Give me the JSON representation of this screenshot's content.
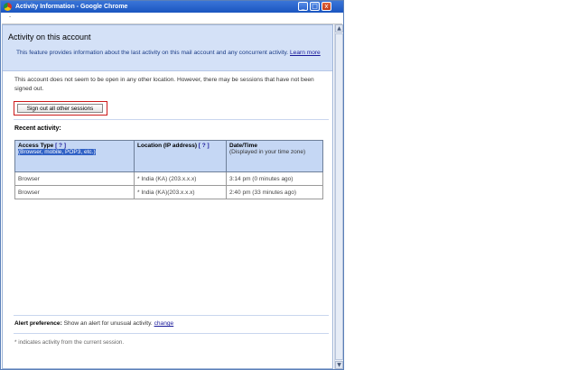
{
  "window": {
    "title": "Activity Information - Google Chrome",
    "address": "-",
    "controls": {
      "minimize": "_",
      "maximize": "□",
      "close": "x"
    }
  },
  "header": {
    "title": "Activity on this account",
    "description": "This feature provides information about the last activity on this mail account and any concurrent activity.",
    "learn_more": "Learn more"
  },
  "note": "This account does not seem to be open in any other location. However, there may be sessions that have not been signed out.",
  "sign_out_button": "Sign out all other sessions",
  "recent_activity_label": "Recent activity:",
  "table": {
    "columns": [
      {
        "label": "Access Type",
        "help": "[ ? ]",
        "sub": "(Browser, mobile, POP3, etc.)"
      },
      {
        "label": "Location (IP address)",
        "help": "[ ? ]",
        "sub": ""
      },
      {
        "label": "Date/Time",
        "help": "",
        "sub": "(Displayed in your time zone)"
      }
    ],
    "rows": [
      {
        "access": "Browser",
        "location": "* India (KA) (203.x.x.x)",
        "time": "3:14 pm (0 minutes ago)"
      },
      {
        "access": "Browser",
        "location": "* India (KA)(203.x.x.x)",
        "time": "2:40 pm (33 minutes ago)"
      }
    ]
  },
  "alert": {
    "label": "Alert preference:",
    "text": "Show an alert for unusual activity.",
    "change": "change"
  },
  "footnote": "* indicates activity from the current session.",
  "colors": {
    "titlebar": "#1a55c0",
    "header_bg": "#d4e1f7",
    "table_header_bg": "#c5d7f4",
    "highlight": "#cc1a1a",
    "selection": "#3162c6"
  },
  "icons": {
    "app": "chrome-icon"
  }
}
